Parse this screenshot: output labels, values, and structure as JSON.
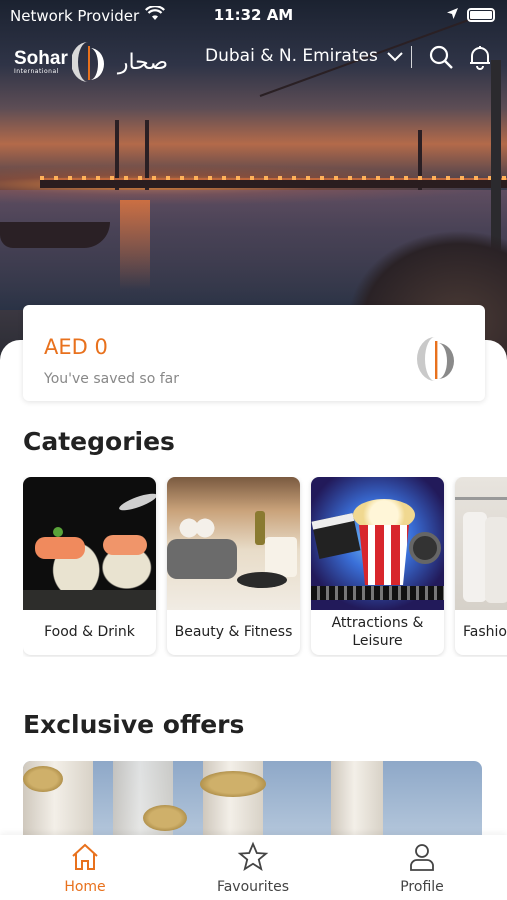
{
  "status_bar": {
    "carrier": "Network Provider",
    "time": "11:32 AM"
  },
  "header": {
    "brand_name": "Sohar",
    "brand_sub": "International",
    "brand_arabic": "صحار",
    "region": "Dubai & N. Emirates",
    "icons": [
      "location-chevron-icon",
      "search-icon",
      "bell-icon"
    ]
  },
  "savings": {
    "amount": "AED 0",
    "caption": "You've saved so far"
  },
  "categories": {
    "title": "Categories",
    "items": [
      {
        "label": "Food & Drink"
      },
      {
        "label": "Beauty & Fitness"
      },
      {
        "label": "Attractions & Leisure"
      },
      {
        "label": "Fashion"
      }
    ]
  },
  "offers": {
    "title": "Exclusive offers"
  },
  "nav": {
    "items": [
      {
        "label": "Home",
        "icon": "home-icon",
        "active": true
      },
      {
        "label": "Favourites",
        "icon": "star-icon",
        "active": false
      },
      {
        "label": "Profile",
        "icon": "profile-icon",
        "active": false
      }
    ]
  },
  "colors": {
    "accent": "#e8711d",
    "text": "#222222",
    "muted": "#888888"
  }
}
